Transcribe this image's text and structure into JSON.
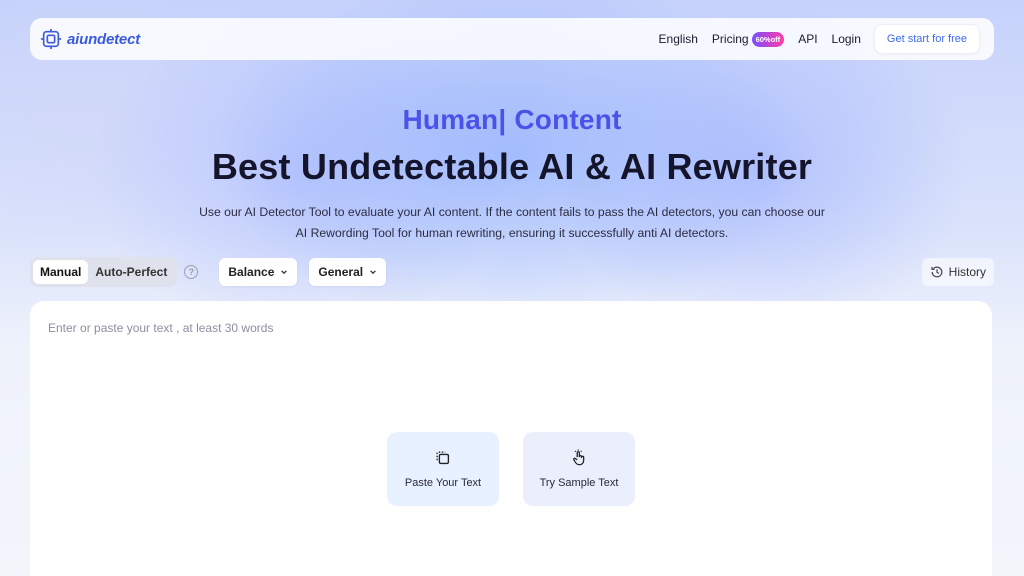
{
  "brand": {
    "name": "aiundetect"
  },
  "nav": {
    "links": [
      "English",
      "Pricing",
      "API",
      "Login"
    ],
    "pricing_badge": "60%off",
    "cta": "Get start for free"
  },
  "hero": {
    "kicker": "Human| Content",
    "title": "Best Undetectable AI & AI Rewriter",
    "description_line1": "Use our AI Detector Tool to evaluate your AI content. If the content fails to pass the AI detectors, you can choose our",
    "description_line2": "AI Rewording Tool for human rewriting, ensuring it successfully anti AI detectors."
  },
  "toolbar": {
    "modes": [
      "Manual",
      "Auto-Perfect"
    ],
    "active_mode": "Manual",
    "help": "?",
    "strength_select": "Balance",
    "purpose_select": "General",
    "history": "History"
  },
  "editor": {
    "placeholder": "Enter or paste your text , at least 30 words",
    "paste_button": "Paste Your Text",
    "sample_button": "Try Sample Text"
  },
  "colors": {
    "accent": "#4a52e8",
    "link_blue": "#3b6cf0",
    "badge_start": "#7b4dff",
    "badge_end": "#ff3ca6"
  }
}
